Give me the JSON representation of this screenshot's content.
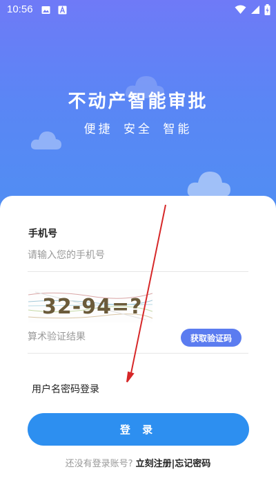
{
  "status_bar": {
    "time": "10:56",
    "icons": [
      "image-icon",
      "a-box-icon",
      "wifi-icon",
      "signal-icon",
      "battery-icon"
    ]
  },
  "hero": {
    "title": "不动产智能审批",
    "subtitle": "便捷  安全  智能"
  },
  "login_form": {
    "phone_label": "手机号",
    "phone_placeholder": "请输入您的手机号",
    "captcha_text": "32-94=?",
    "captcha_placeholder": "算术验证结果",
    "get_code_label": "获取验证码",
    "switch_login_label": "用户名密码登录",
    "login_button_label": "登 录",
    "footer_hint": "还没有登录账号?",
    "register_link": "立刻注册",
    "separator": "|",
    "forgot_link": "忘记密码"
  },
  "colors": {
    "hero_gradient_top": "#6f7af7",
    "hero_gradient_bottom": "#4f8ff2",
    "login_button": "#2d8ff0",
    "get_code_button": "#5b7cf0",
    "annotation_arrow": "#d62728"
  }
}
